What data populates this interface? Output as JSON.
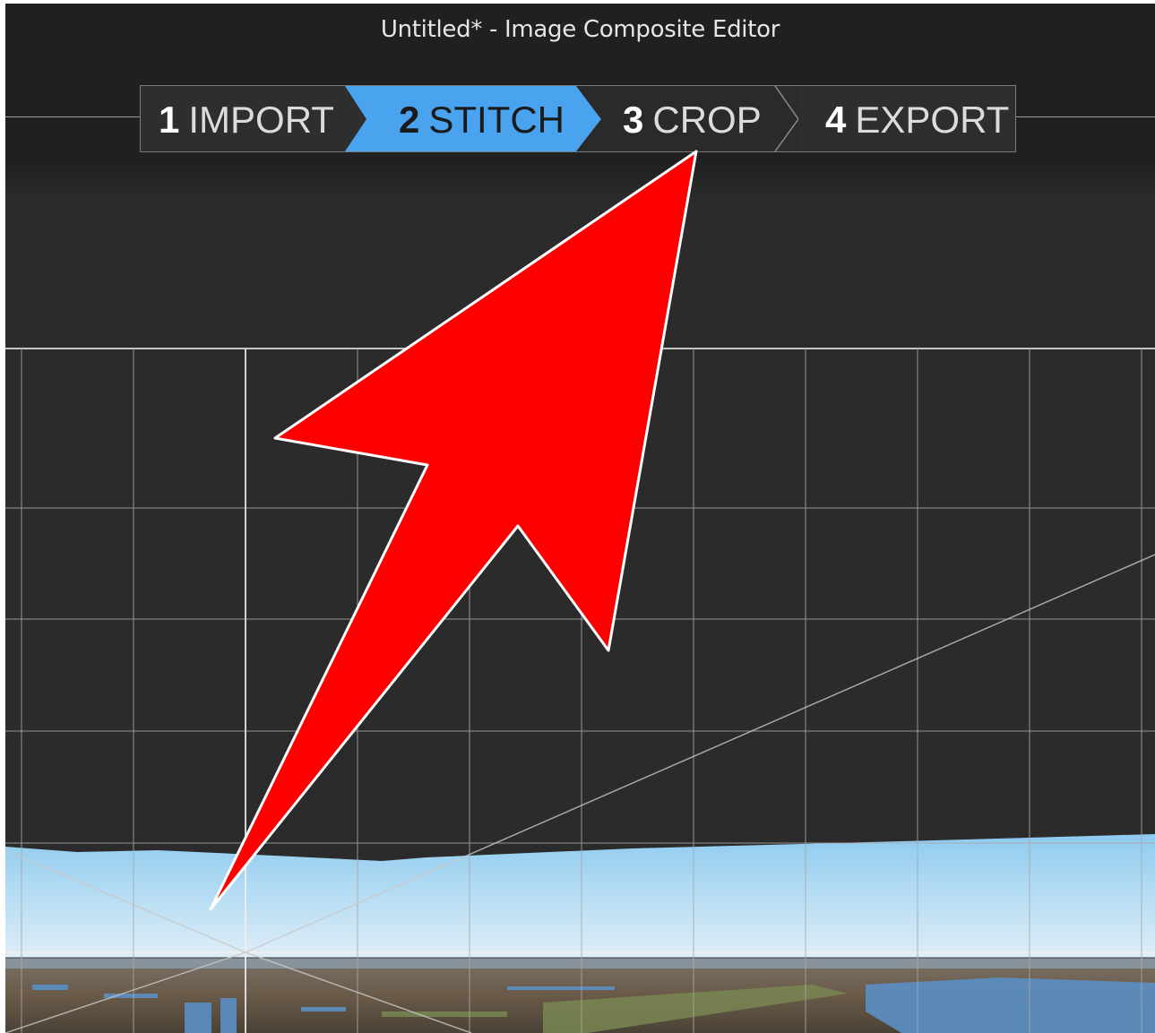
{
  "window": {
    "title": "Untitled* - Image Composite Editor"
  },
  "steps": [
    {
      "number": "1",
      "label": "IMPORT",
      "active": false
    },
    {
      "number": "2",
      "label": "STITCH",
      "active": true
    },
    {
      "number": "3",
      "label": "CROP",
      "active": false
    },
    {
      "number": "4",
      "label": "EXPORT",
      "active": false
    }
  ],
  "colors": {
    "active_step": "#4aa3ee",
    "annotation_arrow": "#ff0000",
    "background": "#2b2b2b"
  },
  "icons": {
    "annotation": "red-arrow-pointing-to-crop-step"
  }
}
